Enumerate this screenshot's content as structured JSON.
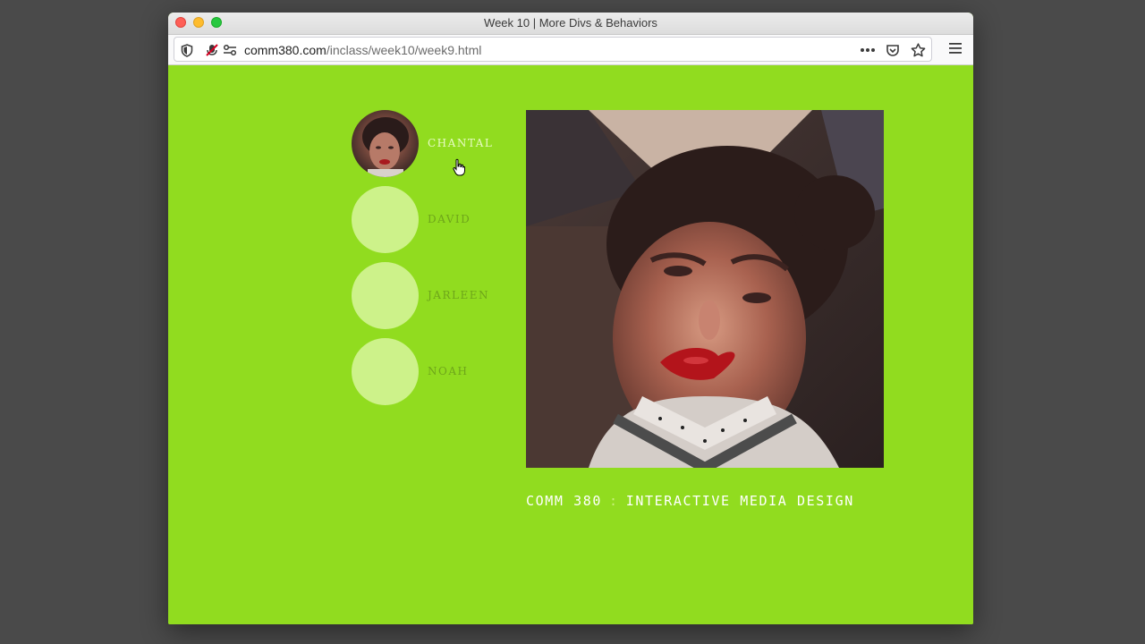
{
  "window": {
    "title": "Week 10 | More Divs & Behaviors"
  },
  "toolbar": {
    "url_domain": "comm380.com",
    "url_path": "/inclass/week10/week9.html",
    "icons": [
      "shield-icon",
      "mic-blocked-icon",
      "permissions-icon",
      "more-icon",
      "pocket-icon",
      "bookmark-star-icon",
      "menu-icon"
    ]
  },
  "people": [
    {
      "name": "CHANTAL",
      "active": true
    },
    {
      "name": "DAVID",
      "active": false
    },
    {
      "name": "JARLEEN",
      "active": false
    },
    {
      "name": "NOAH",
      "active": false
    }
  ],
  "caption": {
    "left": "COMM 380",
    "separator": ":",
    "right": "INTERACTIVE MEDIA DESIGN"
  },
  "colors": {
    "page_background": "#91dc1f",
    "avatar_placeholder": "#cdf28a",
    "name_inactive": "#6ea51a",
    "name_active": "#e8fbc4"
  }
}
